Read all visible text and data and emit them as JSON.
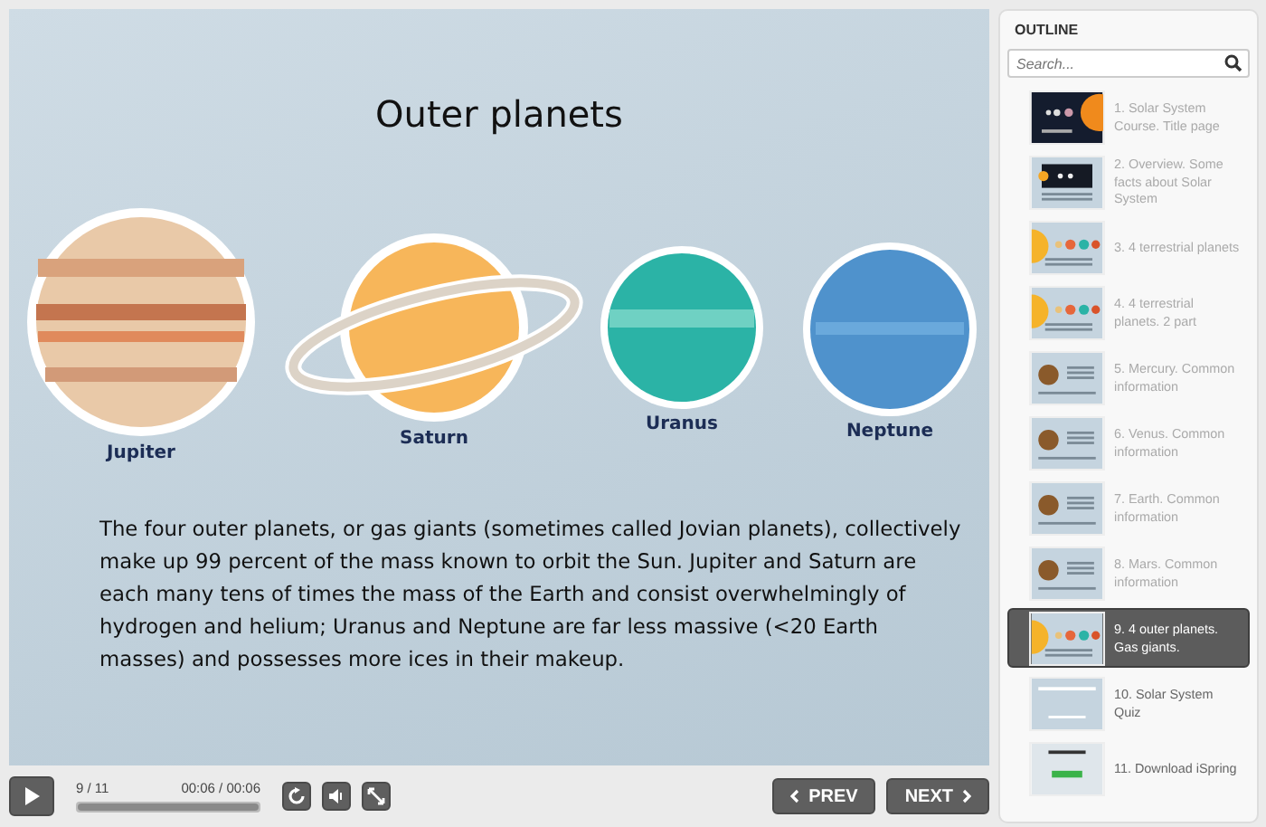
{
  "slide": {
    "title": "Outer planets",
    "planets": [
      {
        "label": "Jupiter",
        "kind": "jupiter"
      },
      {
        "label": "Saturn",
        "kind": "saturn"
      },
      {
        "label": "Uranus",
        "kind": "uranus"
      },
      {
        "label": "Neptune",
        "kind": "neptune"
      }
    ],
    "text": "The four outer planets, or gas giants (sometimes called Jovian planets), collectively make up 99 percent of the mass known to orbit the Sun. Jupiter and Saturn are each many tens of times the mass of the Earth and consist overwhelmingly of hydrogen and helium; Uranus and Neptune are far less massive (<20 Earth masses) and possesses more ices in their makeup."
  },
  "player": {
    "slide_counter": "9 / 11",
    "time": "00:06 / 00:06",
    "level": 1,
    "prev": "PREV",
    "next": "NEXT"
  },
  "outline": {
    "title": "OUTLINE",
    "search": {
      "placeholder": "Search..."
    },
    "items": [
      {
        "label": "1. Solar System Course. Title page",
        "kind": "title",
        "visited": true,
        "selected": false
      },
      {
        "label": "2. Overview. Some facts about Solar System",
        "kind": "overview",
        "visited": true,
        "selected": false
      },
      {
        "label": "3. 4 terrestrial planets",
        "kind": "planets",
        "visited": true,
        "selected": false
      },
      {
        "label": "4. 4 terrestrial planets. 2 part",
        "kind": "planets",
        "visited": true,
        "selected": false
      },
      {
        "label": "5. Mercury. Common information",
        "kind": "info",
        "visited": true,
        "selected": false
      },
      {
        "label": "6. Venus. Common information",
        "kind": "info",
        "visited": true,
        "selected": false
      },
      {
        "label": "7. Earth. Common information",
        "kind": "info",
        "visited": true,
        "selected": false
      },
      {
        "label": "8. Mars. Common information",
        "kind": "info",
        "visited": true,
        "selected": false
      },
      {
        "label": "9. 4 outer planets. Gas giants.",
        "kind": "planets",
        "visited": true,
        "selected": true
      },
      {
        "label": "10. Solar System Quiz",
        "kind": "quiz",
        "visited": false,
        "selected": false
      },
      {
        "label": "11. Download iSpring",
        "kind": "download",
        "visited": false,
        "selected": false
      }
    ]
  }
}
